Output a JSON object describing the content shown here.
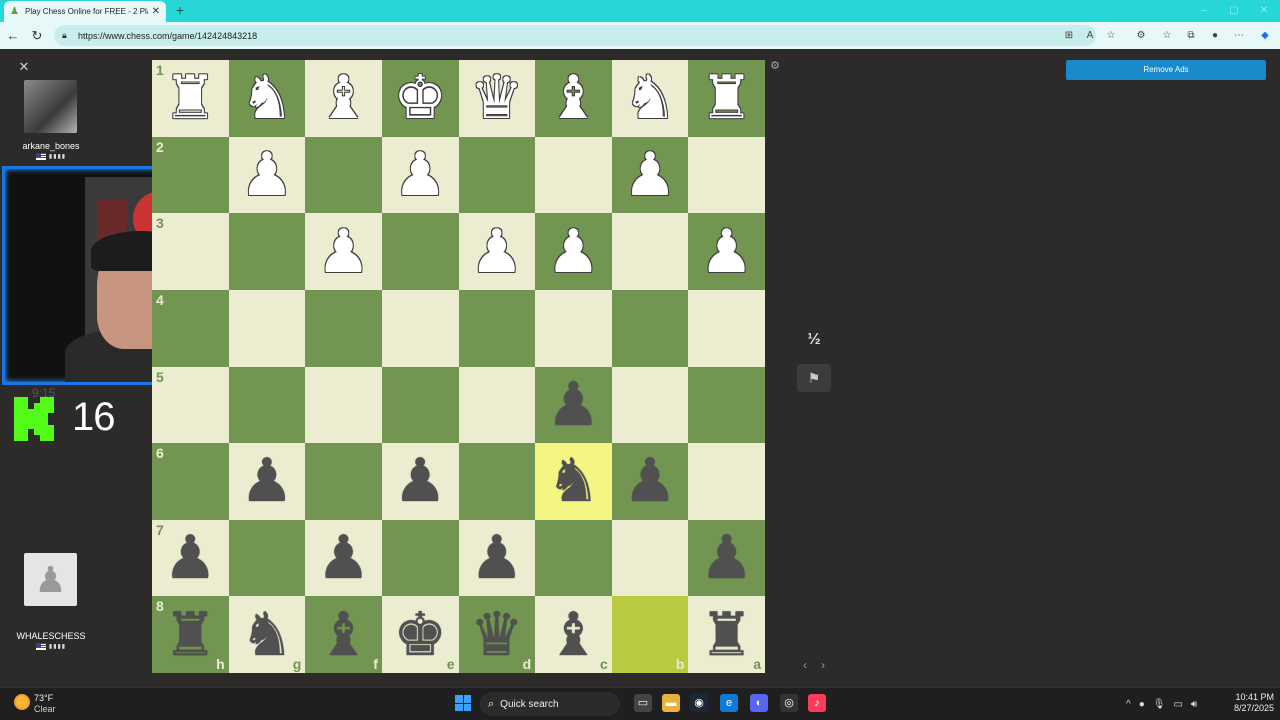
{
  "browser": {
    "tab_title": "Play Chess Online for FREE - 2 Pla",
    "tab_close": "✕",
    "new_tab": "+",
    "url": "https://www.chess.com/game/142424843218"
  },
  "left_panel": {
    "close": "✕",
    "top_player": {
      "name": "arkane_bones",
      "rating": "▮▮▮▮"
    },
    "timer_ghost": "9:15",
    "kick_count": "16",
    "bottom_player": {
      "name": "WHALESCHESS",
      "rating": "▮▮▮▮"
    }
  },
  "board": {
    "rank_labels": [
      "1",
      "2",
      "3",
      "4",
      "5",
      "6",
      "7",
      "8"
    ],
    "file_labels": [
      "h",
      "g",
      "f",
      "e",
      "d",
      "c",
      "b",
      "a"
    ],
    "rows": [
      [
        "wR",
        "wN",
        "wB",
        "wK",
        "wQ",
        "wB",
        "wN",
        "wR"
      ],
      [
        "",
        "wP",
        "",
        "wP",
        "",
        "",
        "wP",
        ""
      ],
      [
        "",
        "",
        "wP",
        "",
        "wP",
        "wP",
        "",
        "wP"
      ],
      [
        "",
        "",
        "",
        "",
        "",
        "",
        "",
        ""
      ],
      [
        "",
        "",
        "",
        "",
        "",
        "bP",
        "",
        ""
      ],
      [
        "",
        "bP",
        "",
        "bP",
        "",
        "bN",
        "bP",
        ""
      ],
      [
        "bP",
        "",
        "bP",
        "",
        "bP",
        "",
        "",
        "bP"
      ],
      [
        "bR",
        "bN",
        "bB",
        "bK",
        "bQ",
        "bB",
        "",
        "bR"
      ]
    ],
    "highlight_yellow": [
      5,
      5
    ],
    "highlight_green": [
      7,
      6
    ]
  },
  "side_controls": {
    "draw": "½",
    "resign": "⚑",
    "prev": "‹",
    "next": "›"
  },
  "ads": {
    "remove_label": "Remove Ads"
  },
  "taskbar": {
    "weather_temp": "73°F",
    "weather_cond": "Clear",
    "search_label": "Quick search",
    "time": "10:41 PM",
    "date": "8/27/2025"
  },
  "colors": {
    "light_square": "#ebecd0",
    "dark_square": "#739552",
    "highlight_yellow": "#f5f682",
    "highlight_green": "#b9ca43",
    "remove_ads": "#1a8acb"
  }
}
